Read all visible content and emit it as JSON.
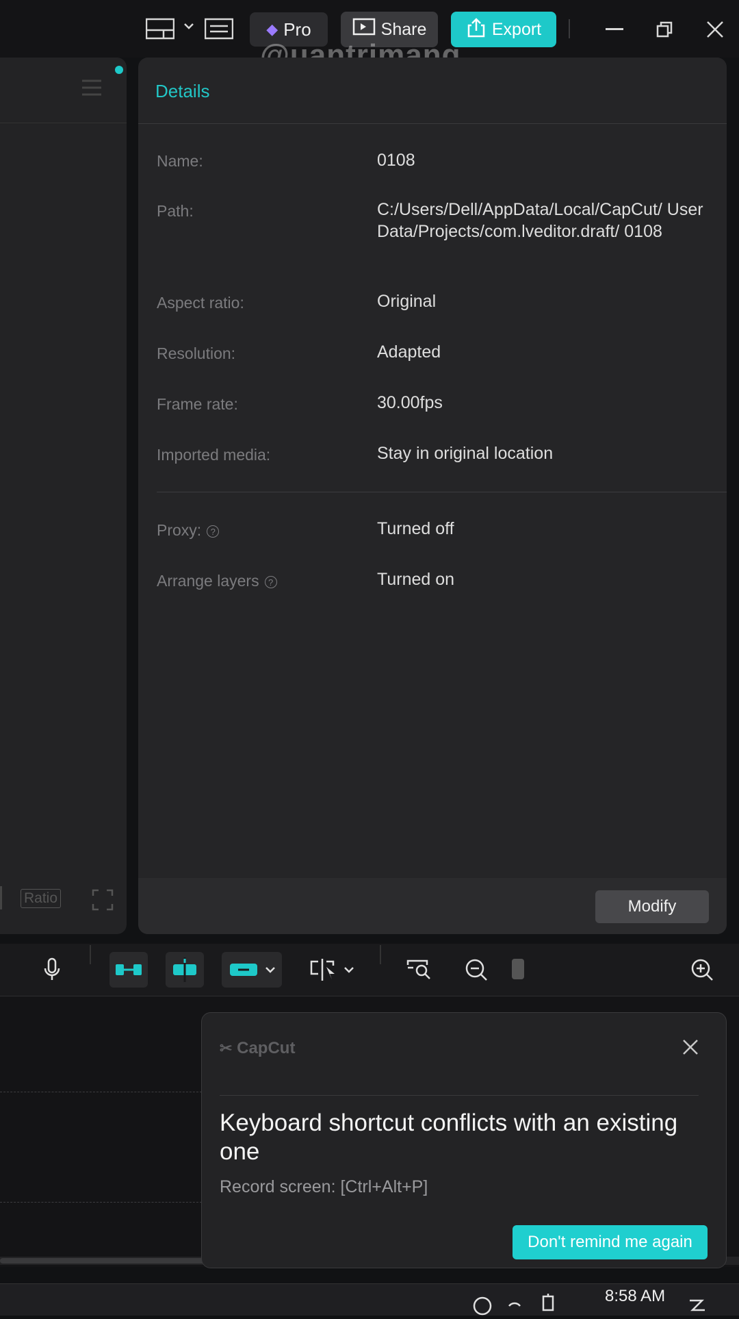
{
  "titlebar": {
    "pro_label": "Pro",
    "share_label": "Share",
    "export_label": "Export",
    "accent_color": "#1ec9c9"
  },
  "watermark": "@uantrimang",
  "left_panel": {
    "ratio_label": "Ratio"
  },
  "details": {
    "title": "Details",
    "rows": [
      {
        "label": "Name:",
        "value": "0108"
      },
      {
        "label": "Path:",
        "value": "C:/Users/Dell/AppData/Local/CapCut/ User Data/Projects/com.lveditor.draft/ 0108"
      },
      {
        "label": "Aspect ratio:",
        "value": "Original"
      },
      {
        "label": "Resolution:",
        "value": "Adapted"
      },
      {
        "label": "Frame rate:",
        "value": "30.00fps"
      },
      {
        "label": "Imported media:",
        "value": "Stay in original location"
      }
    ],
    "settings": [
      {
        "label": "Proxy:",
        "value": "Turned off"
      },
      {
        "label": "Arrange layers",
        "value": "Turned on"
      }
    ],
    "modify_label": "Modify"
  },
  "toast": {
    "brand": "CapCut",
    "title": "Keyboard shortcut conflicts with an existing one",
    "subtitle": "Record screen: [Ctrl+Alt+P]",
    "button_label": "Don't remind me again"
  },
  "taskbar": {
    "time": "8:58 AM"
  }
}
